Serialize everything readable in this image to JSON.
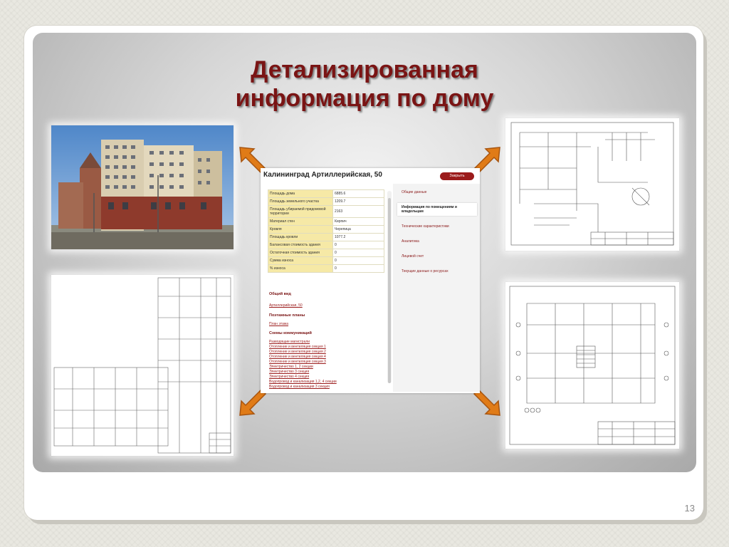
{
  "slide": {
    "title_line1": "Детализированная",
    "title_line2": "информация по дому",
    "page_number": "13"
  },
  "app": {
    "header_title": "Калининград Артиллерийская, 50",
    "close_label": "Закрыть",
    "properties": [
      {
        "label": "Площадь дома",
        "value": "6885.6"
      },
      {
        "label": "Площадь земельного участка",
        "value": "1209.7"
      },
      {
        "label": "Площадь убираемой придомовой территории",
        "value": "2163"
      },
      {
        "label": "Материал стен",
        "value": "Кирпич"
      },
      {
        "label": "Кровля",
        "value": "Черепица"
      },
      {
        "label": "Площадь кровли",
        "value": "1077.2"
      },
      {
        "label": "Балансовая стоимость здания",
        "value": "0"
      },
      {
        "label": "Остаточная стоимость здания",
        "value": "0"
      },
      {
        "label": "Сумма износа",
        "value": "0"
      },
      {
        "label": "% износа",
        "value": "0"
      }
    ],
    "sections": {
      "general_view_title": "Общий вид",
      "general_view_link": "Артиллерийская, 50",
      "floor_plans_title": "Поэтажные планы",
      "floor_plan_link": "План этажа",
      "communications_title": "Схемы коммуникаций",
      "communications_links": [
        "Разводящие магистрали",
        "Отопление и вентиляция секция 1",
        "Отопление и вентиляция секция 2",
        "Отопление и вентиляция секция 4",
        "Отопление и вентиляция секция 3",
        "Электричество 1, 2 секции",
        "Электричество 3 секция",
        "Электричество 4 секция",
        "Водопровод и канализация 1,2, 4 секции",
        "Водопровод и канализация 3 секция"
      ]
    },
    "nav": [
      {
        "label": "Общие данные",
        "active": false
      },
      {
        "label": "Информация по помещениям и владельцам",
        "active": true
      },
      {
        "label": "Технические характеристики",
        "active": false
      },
      {
        "label": "Аналитика",
        "active": false
      },
      {
        "label": "Лицевой счет",
        "active": false
      },
      {
        "label": "Текущие данные о ресурсах",
        "active": false
      }
    ]
  },
  "colors": {
    "title": "#7a1414",
    "arrow": "#e07b17",
    "accent_button": "#9b1b1b",
    "table_key_bg": "#f6e9a6"
  },
  "icons": {
    "arrows": [
      "arrow-up-left-icon",
      "arrow-up-right-icon",
      "arrow-down-left-icon",
      "arrow-down-right-icon"
    ]
  }
}
